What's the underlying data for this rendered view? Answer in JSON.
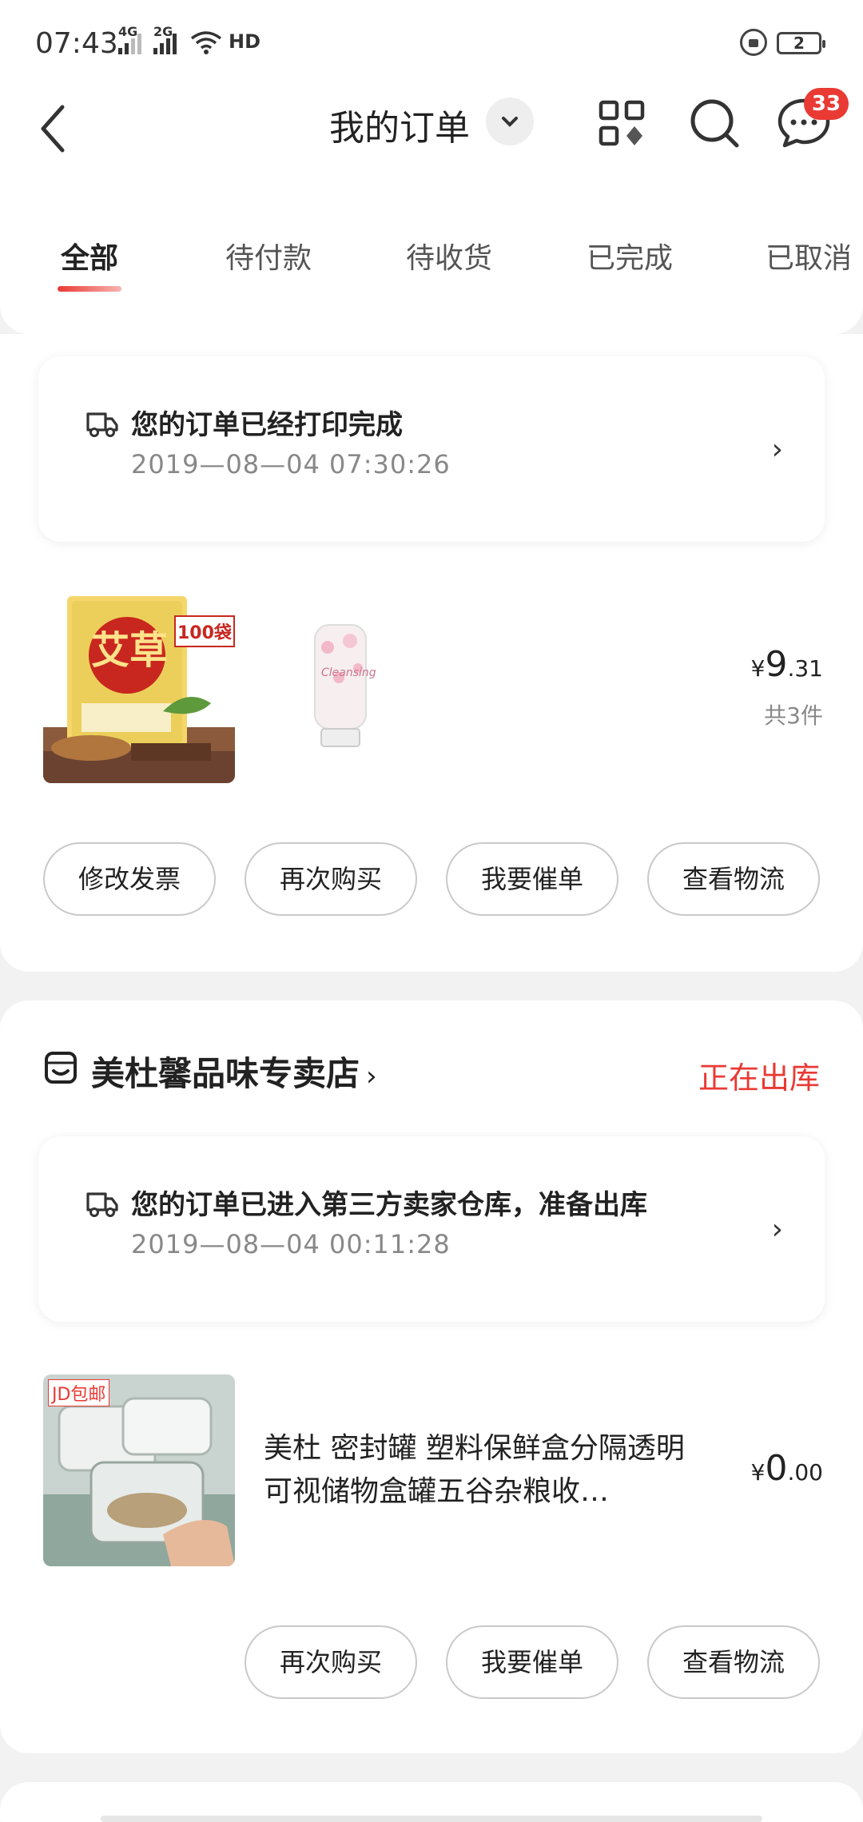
{
  "status_bar": {
    "time": "07:43",
    "net1": "4G",
    "net2": "2G",
    "hd": "HD",
    "battery": "2"
  },
  "nav": {
    "title": "我的订单",
    "badge": "33"
  },
  "tabs": [
    {
      "label": "全部",
      "active": true
    },
    {
      "label": "待付款"
    },
    {
      "label": "待收货"
    },
    {
      "label": "已完成"
    },
    {
      "label": "已取消"
    }
  ],
  "order1": {
    "tracking_message": "您的订单已经打印完成",
    "tracking_time": "2019—08—04 07:30:26",
    "product1_badge": "100袋",
    "product1_title": "艾草",
    "product2_label": "Cleansing",
    "price_symbol": "¥",
    "price_int": "9",
    "price_dec": ".31",
    "count": "共3件",
    "buttons": [
      "修改发票",
      "再次购买",
      "我要催单",
      "查看物流"
    ]
  },
  "order2": {
    "shop_name": "美杜馨品味专卖店",
    "shop_chevron": "›",
    "status": "正在出库",
    "tracking_message": "您的订单已进入第三方卖家仓库，准备出库",
    "tracking_time": "2019—08—04 00:11:28",
    "thumb_tag": "JD包邮",
    "product_name": "美杜 密封罐 塑料保鲜盒分隔透明可视储物盒罐五谷杂粮收…",
    "price_symbol": "¥",
    "price_int": "0",
    "price_dec": ".00",
    "buttons": [
      "再次购买",
      "我要催单",
      "查看物流"
    ]
  }
}
